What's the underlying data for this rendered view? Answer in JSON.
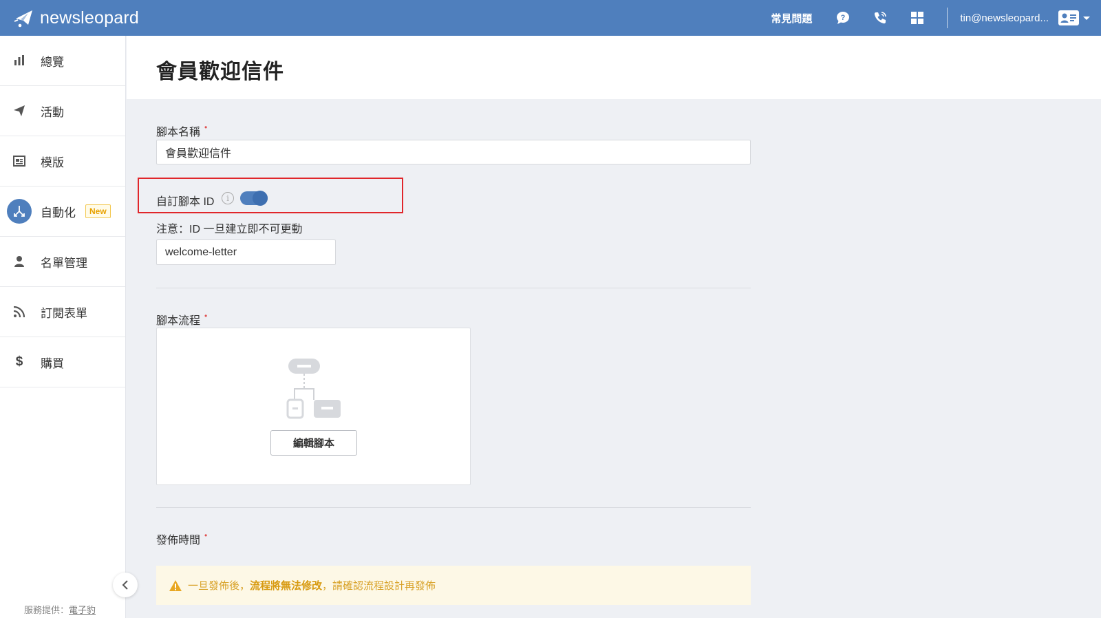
{
  "colors": {
    "primary": "#4f7fbd",
    "warning": "#d8a126",
    "required": "#e05050",
    "highlight": "#e0262b"
  },
  "topbar": {
    "brand": "newsleopard",
    "faq_label": "常見問題",
    "user_email": "tin@newsleopard...",
    "icons": [
      "chat-bubble-question-icon",
      "phone-icon",
      "apps-grid-icon",
      "contact-card-icon"
    ]
  },
  "sidebar": {
    "items": [
      {
        "label": "總覽",
        "icon": "bar-chart-icon"
      },
      {
        "label": "活動",
        "icon": "paper-plane-icon"
      },
      {
        "label": "模版",
        "icon": "template-icon"
      },
      {
        "label": "自動化",
        "icon": "automation-icon",
        "badge": "New",
        "active": true
      },
      {
        "label": "名單管理",
        "icon": "person-icon"
      },
      {
        "label": "訂閱表單",
        "icon": "rss-icon"
      },
      {
        "label": "購買",
        "icon": "dollar-icon"
      }
    ],
    "powered_by_prefix": "服務提供：",
    "powered_by_link": "電子豹"
  },
  "page": {
    "title": "會員歡迎信件",
    "script_name": {
      "label": "腳本名稱",
      "value": "會員歡迎信件",
      "required": "•"
    },
    "custom_id": {
      "label": "自訂腳本 ID",
      "info": "i",
      "enabled": true
    },
    "id_note": "注意：ID 一旦建立即不可更動",
    "id_value": "welcome-letter",
    "flow": {
      "label": "腳本流程",
      "required": "•",
      "button": "編輯腳本"
    },
    "publish": {
      "label": "發佈時間",
      "required": "•"
    },
    "warning": {
      "prefix": "一旦發佈後，",
      "bold": "流程將無法修改",
      "suffix": "，請確認流程設計再發佈"
    }
  }
}
